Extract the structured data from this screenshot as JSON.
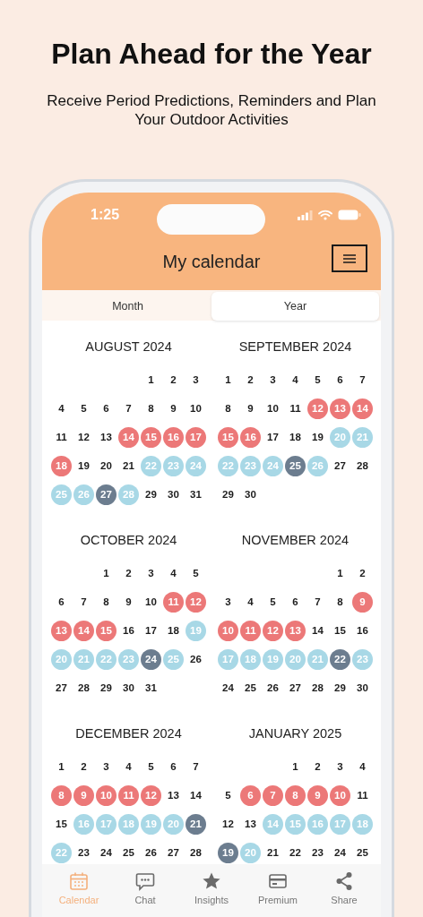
{
  "headline": "Plan Ahead for the Year",
  "subheadline": "Receive Period Predictions, Reminders and Plan Your Outdoor Activities",
  "status_bar": {
    "time": "1:25"
  },
  "app_bar": {
    "title": "My calendar"
  },
  "view_tabs": [
    {
      "label": "Month",
      "selected": false
    },
    {
      "label": "Year",
      "selected": true
    }
  ],
  "months": [
    {
      "title": "AUGUST 2024",
      "weeks": [
        [
          {
            "d": "1",
            "kind": "plain"
          },
          {
            "d": "2",
            "kind": "plain"
          },
          {
            "d": "3",
            "kind": "plain"
          }
        ],
        [
          {
            "d": "4",
            "kind": "plain"
          },
          {
            "d": "5",
            "kind": "plain"
          },
          {
            "d": "6",
            "kind": "plain"
          },
          {
            "d": "7",
            "kind": "plain"
          },
          {
            "d": "8",
            "kind": "plain"
          },
          {
            "d": "9",
            "kind": "plain"
          },
          {
            "d": "10",
            "kind": "plain"
          }
        ],
        [
          {
            "d": "11",
            "kind": "plain"
          },
          {
            "d": "12",
            "kind": "plain"
          },
          {
            "d": "13",
            "kind": "plain"
          },
          {
            "d": "14",
            "kind": "period"
          },
          {
            "d": "15",
            "kind": "period"
          },
          {
            "d": "16",
            "kind": "period"
          },
          {
            "d": "17",
            "kind": "period"
          }
        ],
        [
          {
            "d": "18",
            "kind": "period"
          },
          {
            "d": "19",
            "kind": "plain"
          },
          {
            "d": "20",
            "kind": "plain"
          },
          {
            "d": "21",
            "kind": "plain"
          },
          {
            "d": "22",
            "kind": "fertile"
          },
          {
            "d": "23",
            "kind": "fertile"
          },
          {
            "d": "24",
            "kind": "fertile"
          }
        ],
        [
          {
            "d": "25",
            "kind": "fertile"
          },
          {
            "d": "26",
            "kind": "fertile"
          },
          {
            "d": "27",
            "kind": "ovulation"
          },
          {
            "d": "28",
            "kind": "fertile"
          },
          {
            "d": "29",
            "kind": "plain"
          },
          {
            "d": "30",
            "kind": "plain"
          },
          {
            "d": "31",
            "kind": "plain"
          }
        ]
      ]
    },
    {
      "title": "SEPTEMBER 2024",
      "weeks": [
        [
          {
            "d": "1",
            "kind": "plain"
          },
          {
            "d": "2",
            "kind": "plain"
          },
          {
            "d": "3",
            "kind": "plain"
          },
          {
            "d": "4",
            "kind": "plain"
          },
          {
            "d": "5",
            "kind": "plain"
          },
          {
            "d": "6",
            "kind": "plain"
          },
          {
            "d": "7",
            "kind": "plain"
          }
        ],
        [
          {
            "d": "8",
            "kind": "plain"
          },
          {
            "d": "9",
            "kind": "plain"
          },
          {
            "d": "10",
            "kind": "plain"
          },
          {
            "d": "11",
            "kind": "plain"
          },
          {
            "d": "12",
            "kind": "period"
          },
          {
            "d": "13",
            "kind": "period"
          },
          {
            "d": "14",
            "kind": "period"
          }
        ],
        [
          {
            "d": "15",
            "kind": "period"
          },
          {
            "d": "16",
            "kind": "period"
          },
          {
            "d": "17",
            "kind": "plain"
          },
          {
            "d": "18",
            "kind": "plain"
          },
          {
            "d": "19",
            "kind": "plain"
          },
          {
            "d": "20",
            "kind": "fertile"
          },
          {
            "d": "21",
            "kind": "fertile"
          }
        ],
        [
          {
            "d": "22",
            "kind": "fertile"
          },
          {
            "d": "23",
            "kind": "fertile"
          },
          {
            "d": "24",
            "kind": "fertile"
          },
          {
            "d": "25",
            "kind": "ovulation"
          },
          {
            "d": "26",
            "kind": "fertile"
          },
          {
            "d": "27",
            "kind": "plain"
          },
          {
            "d": "28",
            "kind": "plain"
          }
        ],
        [
          {
            "d": "29",
            "kind": "plain"
          },
          {
            "d": "30",
            "kind": "plain"
          }
        ]
      ]
    },
    {
      "title": "OCTOBER 2024",
      "weeks": [
        [
          {
            "d": "1",
            "kind": "plain"
          },
          {
            "d": "2",
            "kind": "plain"
          },
          {
            "d": "3",
            "kind": "plain"
          },
          {
            "d": "4",
            "kind": "plain"
          },
          {
            "d": "5",
            "kind": "plain"
          }
        ],
        [
          {
            "d": "6",
            "kind": "plain"
          },
          {
            "d": "7",
            "kind": "plain"
          },
          {
            "d": "8",
            "kind": "plain"
          },
          {
            "d": "9",
            "kind": "plain"
          },
          {
            "d": "10",
            "kind": "plain"
          },
          {
            "d": "11",
            "kind": "period"
          },
          {
            "d": "12",
            "kind": "period"
          }
        ],
        [
          {
            "d": "13",
            "kind": "period"
          },
          {
            "d": "14",
            "kind": "period"
          },
          {
            "d": "15",
            "kind": "period"
          },
          {
            "d": "16",
            "kind": "plain"
          },
          {
            "d": "17",
            "kind": "plain"
          },
          {
            "d": "18",
            "kind": "plain"
          },
          {
            "d": "19",
            "kind": "fertile"
          }
        ],
        [
          {
            "d": "20",
            "kind": "fertile"
          },
          {
            "d": "21",
            "kind": "fertile"
          },
          {
            "d": "22",
            "kind": "fertile"
          },
          {
            "d": "23",
            "kind": "fertile"
          },
          {
            "d": "24",
            "kind": "ovulation"
          },
          {
            "d": "25",
            "kind": "fertile"
          },
          {
            "d": "26",
            "kind": "plain"
          }
        ],
        [
          {
            "d": "27",
            "kind": "plain"
          },
          {
            "d": "28",
            "kind": "plain"
          },
          {
            "d": "29",
            "kind": "plain"
          },
          {
            "d": "30",
            "kind": "plain"
          },
          {
            "d": "31",
            "kind": "plain"
          }
        ]
      ]
    },
    {
      "title": "NOVEMBER 2024",
      "weeks": [
        [
          {
            "d": "1",
            "kind": "plain"
          },
          {
            "d": "2",
            "kind": "plain"
          }
        ],
        [
          {
            "d": "3",
            "kind": "plain"
          },
          {
            "d": "4",
            "kind": "plain"
          },
          {
            "d": "5",
            "kind": "plain"
          },
          {
            "d": "6",
            "kind": "plain"
          },
          {
            "d": "7",
            "kind": "plain"
          },
          {
            "d": "8",
            "kind": "plain"
          },
          {
            "d": "9",
            "kind": "period"
          }
        ],
        [
          {
            "d": "10",
            "kind": "period"
          },
          {
            "d": "11",
            "kind": "period"
          },
          {
            "d": "12",
            "kind": "period"
          },
          {
            "d": "13",
            "kind": "period"
          },
          {
            "d": "14",
            "kind": "plain"
          },
          {
            "d": "15",
            "kind": "plain"
          },
          {
            "d": "16",
            "kind": "plain"
          }
        ],
        [
          {
            "d": "17",
            "kind": "fertile"
          },
          {
            "d": "18",
            "kind": "fertile"
          },
          {
            "d": "19",
            "kind": "fertile"
          },
          {
            "d": "20",
            "kind": "fertile"
          },
          {
            "d": "21",
            "kind": "fertile"
          },
          {
            "d": "22",
            "kind": "ovulation"
          },
          {
            "d": "23",
            "kind": "fertile"
          }
        ],
        [
          {
            "d": "24",
            "kind": "plain"
          },
          {
            "d": "25",
            "kind": "plain"
          },
          {
            "d": "26",
            "kind": "plain"
          },
          {
            "d": "27",
            "kind": "plain"
          },
          {
            "d": "28",
            "kind": "plain"
          },
          {
            "d": "29",
            "kind": "plain"
          },
          {
            "d": "30",
            "kind": "plain"
          }
        ]
      ]
    },
    {
      "title": "DECEMBER 2024",
      "weeks": [
        [
          {
            "d": "1",
            "kind": "plain"
          },
          {
            "d": "2",
            "kind": "plain"
          },
          {
            "d": "3",
            "kind": "plain"
          },
          {
            "d": "4",
            "kind": "plain"
          },
          {
            "d": "5",
            "kind": "plain"
          },
          {
            "d": "6",
            "kind": "plain"
          },
          {
            "d": "7",
            "kind": "plain"
          }
        ],
        [
          {
            "d": "8",
            "kind": "period"
          },
          {
            "d": "9",
            "kind": "period"
          },
          {
            "d": "10",
            "kind": "period"
          },
          {
            "d": "11",
            "kind": "period"
          },
          {
            "d": "12",
            "kind": "period"
          },
          {
            "d": "13",
            "kind": "plain"
          },
          {
            "d": "14",
            "kind": "plain"
          }
        ],
        [
          {
            "d": "15",
            "kind": "plain"
          },
          {
            "d": "16",
            "kind": "fertile"
          },
          {
            "d": "17",
            "kind": "fertile"
          },
          {
            "d": "18",
            "kind": "fertile"
          },
          {
            "d": "19",
            "kind": "fertile"
          },
          {
            "d": "20",
            "kind": "fertile"
          },
          {
            "d": "21",
            "kind": "ovulation"
          }
        ],
        [
          {
            "d": "22",
            "kind": "fertile"
          },
          {
            "d": "23",
            "kind": "plain"
          },
          {
            "d": "24",
            "kind": "plain"
          },
          {
            "d": "25",
            "kind": "plain"
          },
          {
            "d": "26",
            "kind": "plain"
          },
          {
            "d": "27",
            "kind": "plain"
          },
          {
            "d": "28",
            "kind": "plain"
          }
        ]
      ]
    },
    {
      "title": "JANUARY 2025",
      "weeks": [
        [
          {
            "d": "1",
            "kind": "plain"
          },
          {
            "d": "2",
            "kind": "plain"
          },
          {
            "d": "3",
            "kind": "plain"
          },
          {
            "d": "4",
            "kind": "plain"
          }
        ],
        [
          {
            "d": "5",
            "kind": "plain"
          },
          {
            "d": "6",
            "kind": "period"
          },
          {
            "d": "7",
            "kind": "period"
          },
          {
            "d": "8",
            "kind": "period"
          },
          {
            "d": "9",
            "kind": "period"
          },
          {
            "d": "10",
            "kind": "period"
          },
          {
            "d": "11",
            "kind": "plain"
          }
        ],
        [
          {
            "d": "12",
            "kind": "plain"
          },
          {
            "d": "13",
            "kind": "plain"
          },
          {
            "d": "14",
            "kind": "fertile"
          },
          {
            "d": "15",
            "kind": "fertile"
          },
          {
            "d": "16",
            "kind": "fertile"
          },
          {
            "d": "17",
            "kind": "fertile"
          },
          {
            "d": "18",
            "kind": "fertile"
          }
        ],
        [
          {
            "d": "19",
            "kind": "ovulation"
          },
          {
            "d": "20",
            "kind": "fertile"
          },
          {
            "d": "21",
            "kind": "plain"
          },
          {
            "d": "22",
            "kind": "plain"
          },
          {
            "d": "23",
            "kind": "plain"
          },
          {
            "d": "24",
            "kind": "plain"
          },
          {
            "d": "25",
            "kind": "plain"
          }
        ]
      ]
    }
  ],
  "bottom_nav": [
    {
      "label": "Calendar",
      "kind": "calendar",
      "selected": true
    },
    {
      "label": "Chat",
      "kind": "chat",
      "selected": false
    },
    {
      "label": "Insights",
      "kind": "star",
      "selected": false
    },
    {
      "label": "Premium",
      "kind": "card",
      "selected": false
    },
    {
      "label": "Share",
      "kind": "share",
      "selected": false
    }
  ]
}
